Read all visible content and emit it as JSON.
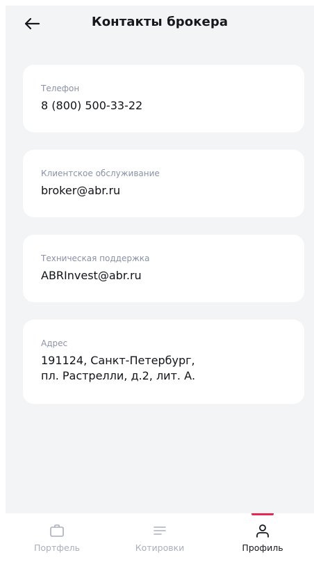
{
  "header": {
    "title": "Контакты брокера",
    "back_icon": "arrow-left-icon"
  },
  "contacts": [
    {
      "label": "Телефон",
      "value": "8 (800) 500-33-22"
    },
    {
      "label": "Клиентское обслуживание",
      "value": "broker@abr.ru"
    },
    {
      "label": "Техническая поддержка",
      "value": "ABRInvest@abr.ru"
    },
    {
      "label": "Адрес",
      "value": "191124, Санкт-Петербург,\nпл. Растрелли, д.2, лит. А."
    }
  ],
  "tabbar": {
    "items": [
      {
        "label": "Портфель",
        "icon": "briefcase-icon",
        "active": false
      },
      {
        "label": "Котировки",
        "icon": "list-icon",
        "active": false
      },
      {
        "label": "Профиль",
        "icon": "user-icon",
        "active": true
      }
    ],
    "accent_color": "#e2294f"
  }
}
